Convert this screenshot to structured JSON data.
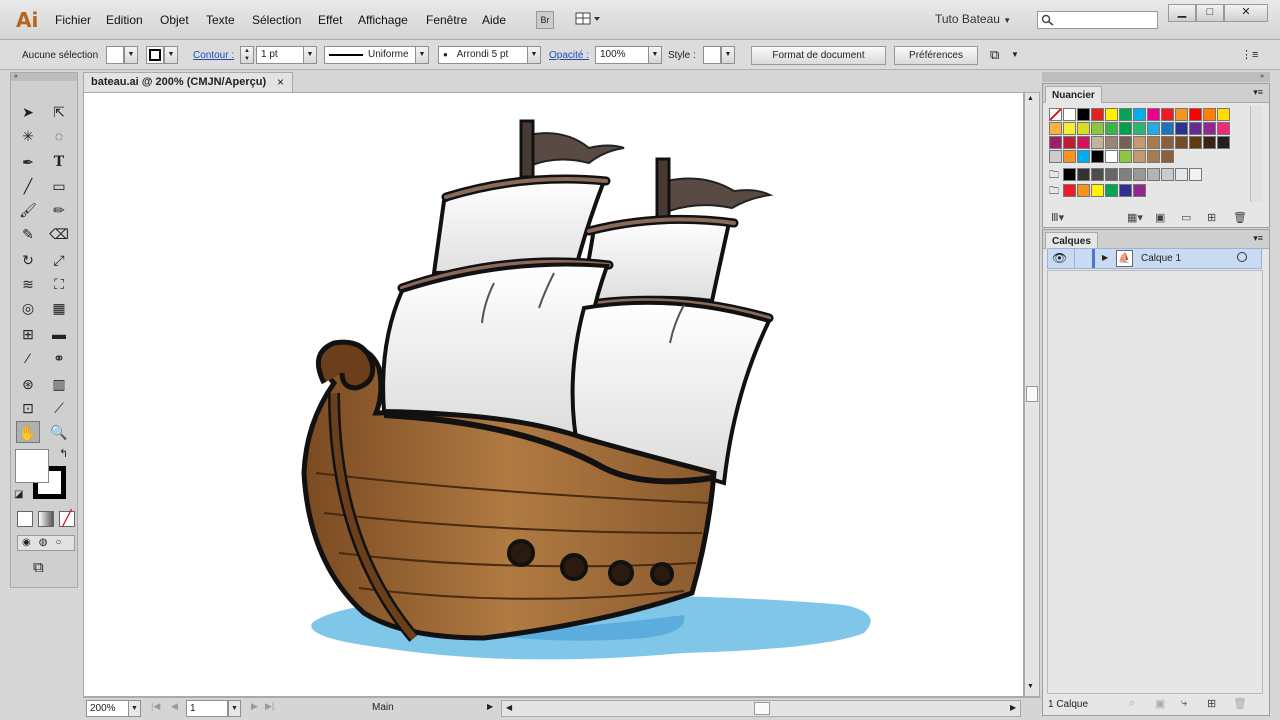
{
  "app": {
    "logo": "Ai",
    "workspace": "Tuto Bateau"
  },
  "menu": [
    "Fichier",
    "Edition",
    "Objet",
    "Texte",
    "Sélection",
    "Effet",
    "Affichage",
    "Fenêtre",
    "Aide"
  ],
  "menubar_buttons": {
    "bridge": "Br"
  },
  "controlbar": {
    "selection": "Aucune sélection",
    "contour_label": "Contour :",
    "stroke_weight": "1 pt",
    "stroke_profile": "Uniforme",
    "brush": "Arrondi 5 pt",
    "opacity_label": "Opacité :",
    "opacity_value": "100%",
    "style_label": "Style :",
    "doc_setup_button": "Format de document",
    "prefs_button": "Préférences"
  },
  "document": {
    "tab_title": "bateau.ai @ 200% (CMJN/Aperçu)",
    "close": "×"
  },
  "statusbar": {
    "zoom": "200%",
    "artboard": "1",
    "tool": "Main"
  },
  "swatches_panel": {
    "title": "Nuancier",
    "rows": [
      [
        "#ffffff",
        "#ffffff",
        "#000000",
        "#e2231a",
        "#fff200",
        "#00a651",
        "#00aeef",
        "#ec008c",
        "#ed1c24",
        "#f7941d",
        "#ff0000",
        "#ff7f00",
        "#ffdd00"
      ],
      [
        "#fbb040",
        "#f9ed32",
        "#d7df23",
        "#8dc63f",
        "#39b54a",
        "#00a14b",
        "#2bb673",
        "#27aae1",
        "#1c75bc",
        "#2e3192",
        "#662d91",
        "#92278f",
        "#ee2a7b"
      ],
      [
        "#9e1f63",
        "#be1e2d",
        "#d2145a",
        "#c2b59b",
        "#998675",
        "#736357",
        "#c49a6c",
        "#a97c50",
        "#8b5e3c",
        "#754c29",
        "#603913",
        "#3c2415",
        "#231f20"
      ],
      [
        "#cccccc",
        "#f7941d",
        "#00aeef",
        "#000000",
        "#ffffff",
        "#8dc63f",
        "#c49a6c",
        "#a97c50",
        "#8b5e3c"
      ],
      [
        "#000000",
        "#333333",
        "#4d4d4d",
        "#666666",
        "#808080",
        "#999999",
        "#b3b3b3",
        "#cccccc",
        "#e6e6e6",
        "#f2f2f2"
      ],
      [
        "#ed1c24",
        "#f7941d",
        "#fff200",
        "#00a651",
        "#2e3192",
        "#92278f"
      ]
    ]
  },
  "layers_panel": {
    "title": "Calques",
    "layer_name": "Calque 1",
    "count": "1 Calque"
  }
}
